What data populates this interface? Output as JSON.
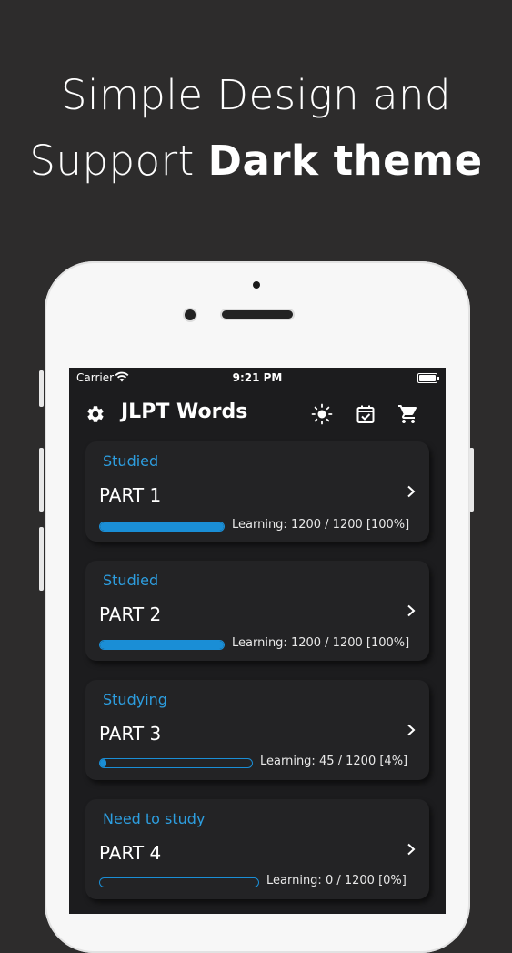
{
  "headline": {
    "line1": "Simple Design and",
    "line2_prefix": "Support ",
    "line2_bold": "Dark theme"
  },
  "status_bar": {
    "carrier": "Carrier",
    "time": "9:21 PM"
  },
  "app": {
    "title": "JLPT Words"
  },
  "icons": {
    "settings": "gear-icon",
    "theme": "sun-icon",
    "calendar": "calendar-check-icon",
    "shop": "cart-icon",
    "open_part": "chevron-right-icon"
  },
  "colors": {
    "background": "#2d2c2c",
    "screen": "#1c1c1e",
    "card": "#232325",
    "accent": "#1a8ed6",
    "status_text": "#2d9ee0"
  },
  "parts": [
    {
      "status": "Studied",
      "title": "PART 1",
      "progress": 1.0,
      "progress_text": "Learning: 1200 / 1200 [100%]"
    },
    {
      "status": "Studied",
      "title": "PART 2",
      "progress": 1.0,
      "progress_text": "Learning: 1200 / 1200 [100%]"
    },
    {
      "status": "Studying",
      "title": "PART 3",
      "progress": 0.04,
      "progress_text": "Learning: 45 / 1200 [4%]"
    },
    {
      "status": "Need to study",
      "title": "PART 4",
      "progress": 0.0,
      "progress_text": "Learning: 0 / 1200 [0%]"
    }
  ]
}
